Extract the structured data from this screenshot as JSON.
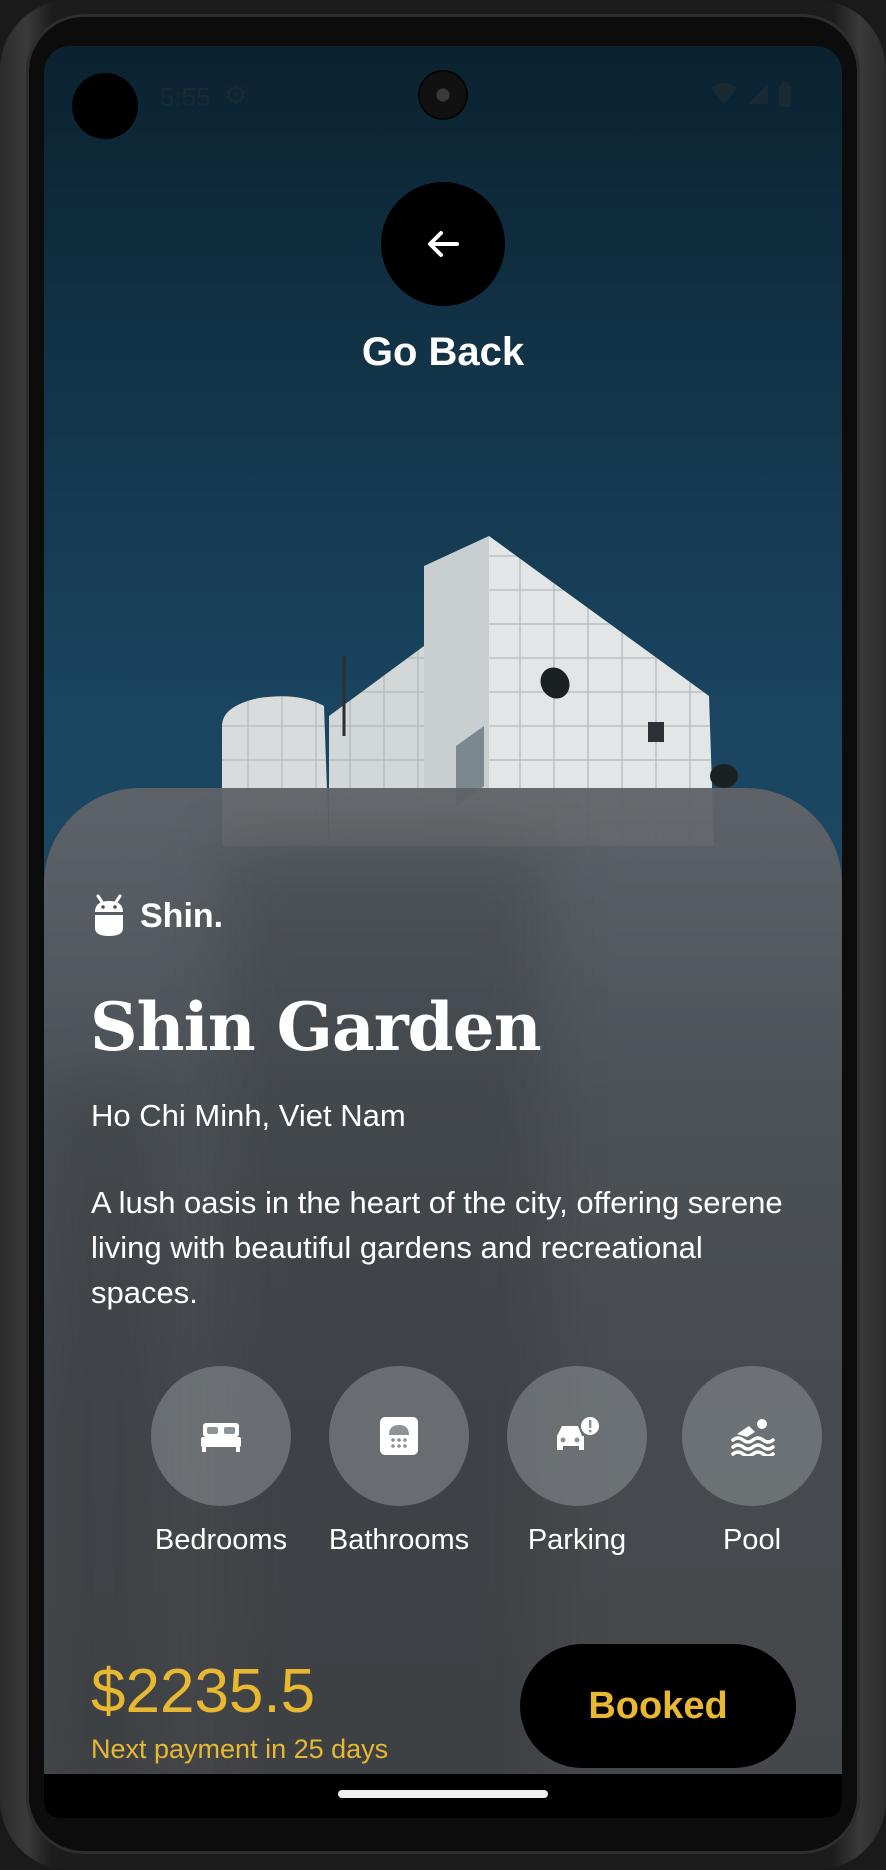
{
  "status_bar": {
    "time": "5:55",
    "settings_icon": "gear-icon",
    "wifi_icon": "wifi-icon",
    "signal_icon": "signal-icon",
    "battery_icon": "battery-icon"
  },
  "header": {
    "back_icon": "arrow-left-icon",
    "back_label": "Go Back"
  },
  "property": {
    "brand_icon": "android-icon",
    "brand_name": "Shin.",
    "title": "Shin Garden",
    "location": "Ho Chi Minh, Viet Nam",
    "description": "A lush oasis in the heart of the city, offering serene living with beautiful gardens and recreational spaces.",
    "amenities": [
      {
        "label": "Bedrooms",
        "icon": "bed-icon"
      },
      {
        "label": "Bathrooms",
        "icon": "shower-icon"
      },
      {
        "label": "Parking",
        "icon": "car-alert-icon"
      },
      {
        "label": "Pool",
        "icon": "swimmer-icon"
      }
    ]
  },
  "footer": {
    "price": "$2235.5",
    "next_payment": "Next payment in 25 days",
    "button_label": "Booked"
  },
  "colors": {
    "accent": "#e8b830",
    "sky": "#1c4a66",
    "panel": "#4e5256"
  }
}
